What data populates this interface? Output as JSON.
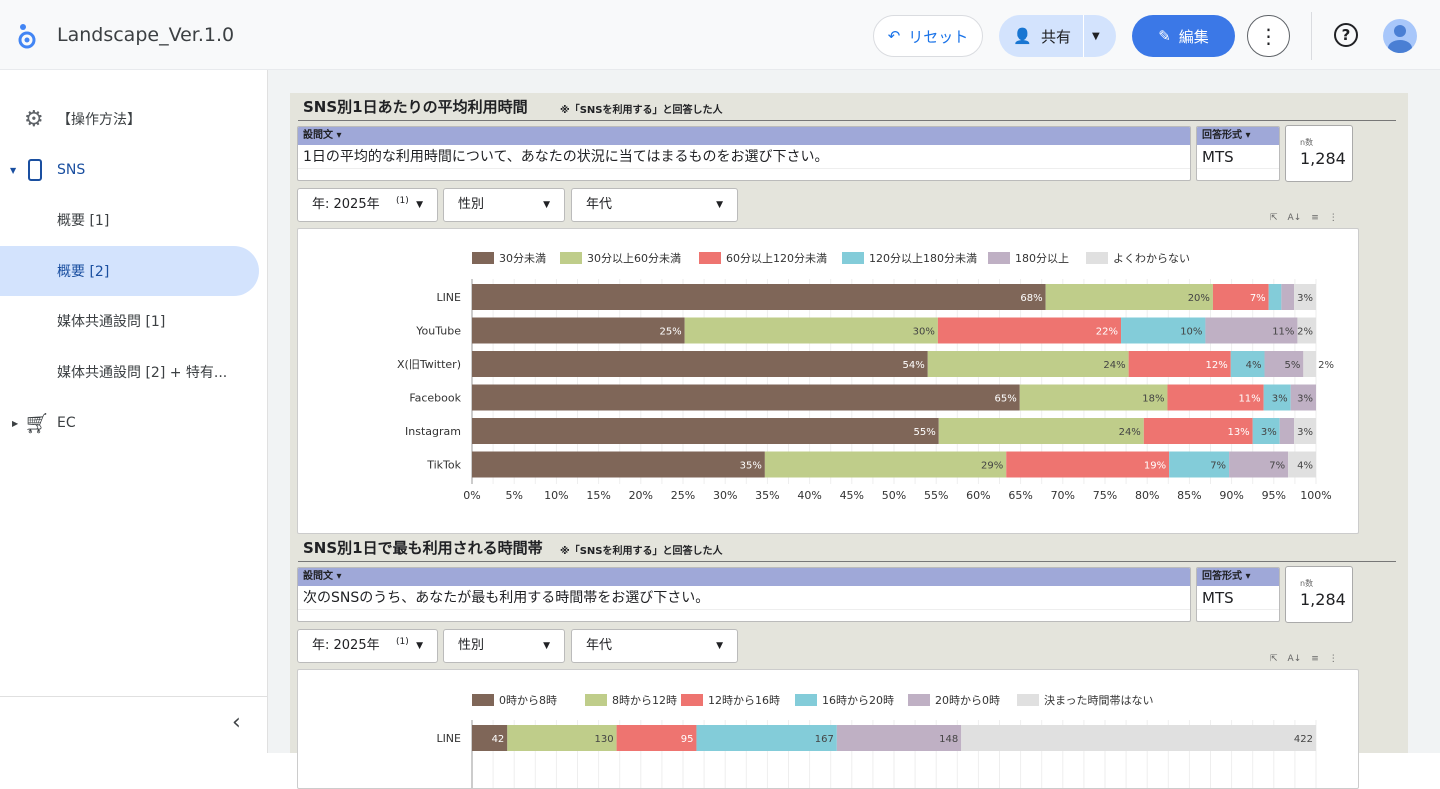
{
  "header": {
    "title": "Landscape_Ver.1.0",
    "reset_label": "リセット",
    "share_label": "共有",
    "edit_label": "編集",
    "more_label": "⋮",
    "help_label": "?"
  },
  "sidebar": {
    "items": [
      {
        "label": "【操作方法】",
        "icon": "gear-icon"
      },
      {
        "label": "SNS",
        "icon": "phone-icon"
      },
      {
        "label": "概要 [1]"
      },
      {
        "label": "概要 [2]",
        "active": true
      },
      {
        "label": "媒体共通設問 [1]"
      },
      {
        "label": "媒体共通設問 [2] + 特有..."
      },
      {
        "label": "EC",
        "icon": "cart-icon"
      }
    ],
    "collapse_label": "‹"
  },
  "sections": [
    {
      "title": "SNS別1日あたりの平均利用時間",
      "note": "※「SNSを利用する」と回答した人",
      "question_header": "設問文 ▾",
      "question": "1日の平均的な利用時間について、あなたの状況に当てはまるものをお選び下さい。",
      "format_header": "回答形式 ▾",
      "format": "MTS",
      "n_label": "n数",
      "n_value": "1,284",
      "filters": {
        "year": "年: 2025年",
        "year_count": "(1)",
        "gender": "性別",
        "age": "年代"
      }
    },
    {
      "title": "SNS別1日で最も利用される時間帯",
      "note": "※「SNSを利用する」と回答した人",
      "question_header": "設問文 ▾",
      "question": "次のSNSのうち、あなたが最も利用する時間帯をお選び下さい。",
      "format_header": "回答形式 ▾",
      "format": "MTS",
      "n_label": "n数",
      "n_value": "1,284",
      "filters": {
        "year": "年: 2025年",
        "year_count": "(1)",
        "gender": "性別",
        "age": "年代"
      }
    }
  ],
  "chart_data": [
    {
      "type": "bar",
      "orientation": "horizontal",
      "stacked": "percent",
      "categories": [
        "LINE",
        "YouTube",
        "X(旧Twitter)",
        "Facebook",
        "Instagram",
        "TikTok"
      ],
      "series": [
        {
          "name": "30分未満",
          "color": "#7f6658",
          "values": [
            67.9,
            25.2,
            54.0,
            64.9,
            55.3,
            34.7
          ],
          "labels": [
            "68%",
            "25%",
            "54%",
            "65%",
            "55%",
            "35%"
          ]
        },
        {
          "name": "30分以上60分未満",
          "color": "#bfcd8a",
          "values": [
            19.8,
            30.0,
            23.8,
            17.5,
            24.3,
            28.6
          ],
          "labels": [
            "20%",
            "30%",
            "24%",
            "18%",
            "24%",
            "29%"
          ]
        },
        {
          "name": "60分以上120分未満",
          "color": "#ee7470",
          "values": [
            6.6,
            21.7,
            12.1,
            11.4,
            12.9,
            19.3
          ],
          "labels": [
            "7%",
            "22%",
            "12%",
            "11%",
            "13%",
            "19%"
          ]
        },
        {
          "name": "120分以上180分未満",
          "color": "#83ccd9",
          "values": [
            1.5,
            10.0,
            4.0,
            3.2,
            3.2,
            7.1
          ],
          "labels": [
            "",
            "10%",
            "4%",
            "3%",
            "3%",
            "7%"
          ]
        },
        {
          "name": "180分以上",
          "color": "#bfb0c4",
          "values": [
            1.5,
            10.9,
            4.6,
            3.0,
            1.7,
            7.0
          ],
          "labels": [
            "",
            "11%",
            "5%",
            "3%",
            "",
            "7%"
          ]
        },
        {
          "name": "よくわからない",
          "color": "#e0e0e0",
          "values": [
            2.6,
            2.2,
            1.5,
            0,
            2.6,
            3.3
          ],
          "labels": [
            "3%",
            "2%",
            "2%",
            "",
            "3%",
            "4%"
          ]
        }
      ],
      "xticks": [
        "0%",
        "5%",
        "10%",
        "15%",
        "20%",
        "25%",
        "30%",
        "35%",
        "40%",
        "45%",
        "50%",
        "55%",
        "60%",
        "65%",
        "70%",
        "75%",
        "80%",
        "85%",
        "90%",
        "95%",
        "100%"
      ],
      "xlim": [
        0,
        100
      ],
      "legend": "top"
    },
    {
      "type": "bar",
      "orientation": "horizontal",
      "stacked": "percent",
      "categories": [
        "LINE"
      ],
      "series": [
        {
          "name": "0時から8時",
          "color": "#7f6658",
          "values": [
            42
          ],
          "labels": [
            "42"
          ]
        },
        {
          "name": "8時から12時",
          "color": "#bfcd8a",
          "values": [
            130
          ],
          "labels": [
            "130"
          ]
        },
        {
          "name": "12時から16時",
          "color": "#ee7470",
          "values": [
            95
          ],
          "labels": [
            "95"
          ]
        },
        {
          "name": "16時から20時",
          "color": "#83ccd9",
          "values": [
            167
          ],
          "labels": [
            "167"
          ]
        },
        {
          "name": "20時から0時",
          "color": "#bfb0c4",
          "values": [
            148
          ],
          "labels": [
            "148"
          ]
        },
        {
          "name": "決まった時間帯はない",
          "color": "#e0e0e0",
          "values": [
            422
          ],
          "labels": [
            "422"
          ]
        }
      ],
      "legend": "top"
    }
  ]
}
